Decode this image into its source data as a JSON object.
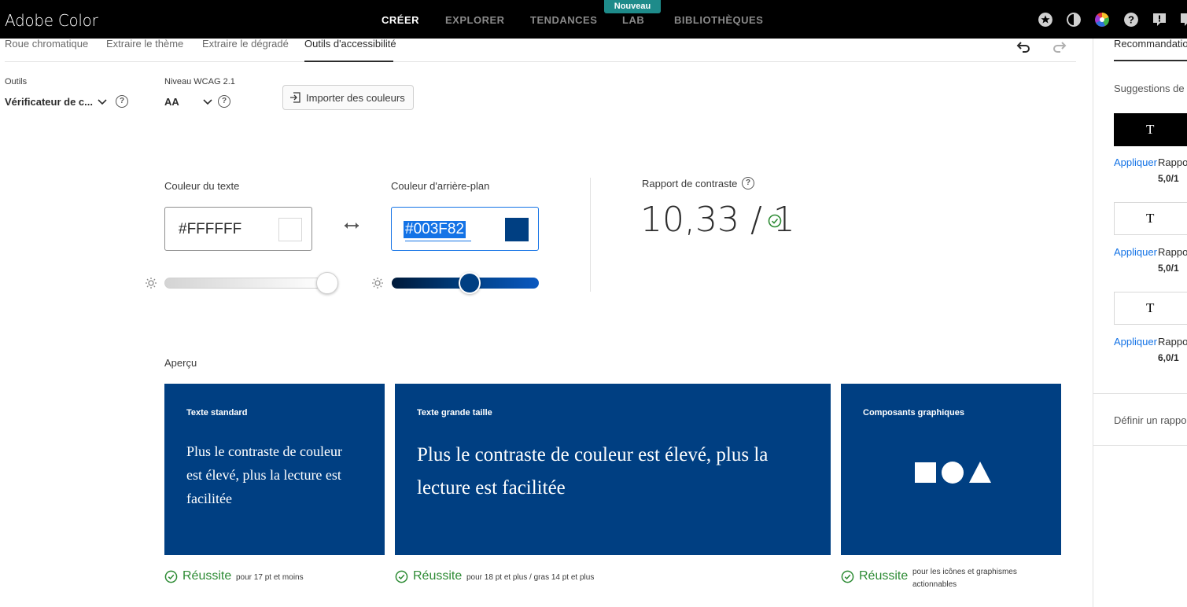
{
  "app": {
    "title": "Adobe Color"
  },
  "nav": {
    "items": [
      "CRÉER",
      "EXPLORER",
      "TENDANCES",
      "LAB",
      "BIBLIOTHÈQUES"
    ],
    "new_badge": "Nouveau"
  },
  "subtabs": [
    "Roue chromatique",
    "Extraire le thème",
    "Extraire le dégradé",
    "Outils d'accessibilité"
  ],
  "tools": {
    "tools_label": "Outils",
    "tools_value": "Vérificateur de c...",
    "wcag_label": "Niveau WCAG 2.1",
    "wcag_value": "AA",
    "import_label": "Importer des couleurs"
  },
  "text_color": {
    "label": "Couleur du texte",
    "hex": "#FFFFFF",
    "brightness": 1.0
  },
  "background_color": {
    "label": "Couleur d'arrière-plan",
    "hex": "#003F82",
    "brightness": 0.53
  },
  "contrast": {
    "label": "Rapport de contraste",
    "value": "10,33 / 1"
  },
  "preview": {
    "title": "Aperçu",
    "cards": [
      {
        "title": "Texte standard",
        "text": "Plus le contraste de couleur est élevé, plus la lecture est facilitée",
        "status": "Réussite",
        "desc": "pour 17 pt et moins"
      },
      {
        "title": "Texte grande taille",
        "text": "Plus le contraste de couleur est élevé, plus la lecture est facilitée",
        "status": "Réussite",
        "desc": "pour 18 pt et plus / gras 14 pt et plus"
      },
      {
        "title": "Composants graphiques",
        "text": "",
        "status": "Réussite",
        "desc": "pour les icônes et graphismes actionnables"
      }
    ]
  },
  "right_panel": {
    "tab": "Recommandations",
    "suggestions_label": "Suggestions de couleurs",
    "items": [
      {
        "glyph": "T",
        "apply": "Appliquer",
        "ratio_label": "Rapport",
        "ratio": "5,0/1",
        "bg": "#000000",
        "fg": "#ffffff"
      },
      {
        "glyph": "T",
        "apply": "Appliquer",
        "ratio_label": "Rapport",
        "ratio": "5,0/1",
        "bg": "#ffffff",
        "fg": "#000000"
      },
      {
        "glyph": "T",
        "apply": "Appliquer",
        "ratio_label": "Rapport",
        "ratio": "6,0/1",
        "bg": "#ffffff",
        "fg": "#000000"
      }
    ],
    "define_label": "Définir un rapport"
  },
  "colors": {
    "accent_blue": "#003F82",
    "pass_green": "#2d8b34",
    "link_blue": "#1473e6",
    "badge_teal": "#1e8b8a"
  }
}
